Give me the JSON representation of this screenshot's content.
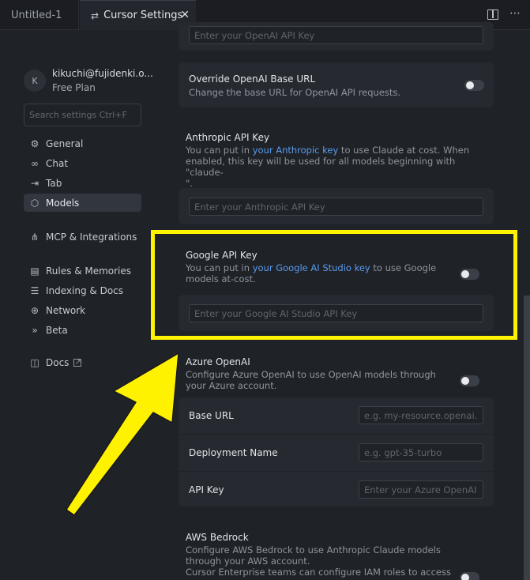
{
  "tabs": {
    "untitled": "Untitled-1",
    "settings": "Cursor Settings"
  },
  "user": {
    "initial": "K",
    "email": "kikuchi@fujidenki.o...",
    "plan": "Free Plan"
  },
  "sidebar": {
    "search_placeholder": "Search settings Ctrl+F",
    "items": [
      {
        "label": "General",
        "icon": "gear-icon"
      },
      {
        "label": "Chat",
        "icon": "infinity-icon"
      },
      {
        "label": "Tab",
        "icon": "arrow-right-bar-icon"
      },
      {
        "label": "Models",
        "icon": "cube-icon"
      },
      {
        "label": "MCP & Integrations",
        "icon": "network-nodes-icon"
      },
      {
        "label": "Rules & Memories",
        "icon": "document-icon"
      },
      {
        "label": "Indexing & Docs",
        "icon": "database-icon"
      },
      {
        "label": "Network",
        "icon": "globe-icon"
      },
      {
        "label": "Beta",
        "icon": "chevrons-right-icon"
      },
      {
        "label": "Docs",
        "icon": "book-icon"
      }
    ]
  },
  "main": {
    "openai_key_placeholder": "Enter your OpenAI API Key",
    "override_base": {
      "title": "Override OpenAI Base URL",
      "desc": "Change the base URL for OpenAI API requests."
    },
    "anthropic": {
      "title": "Anthropic API Key",
      "desc_pre": "You can put in ",
      "link": "your Anthropic key",
      "desc_post": " to use Claude at cost. When",
      "desc_line2": "enabled, this key will be used for all models beginning with \"claude-",
      "desc_line3": "\".",
      "placeholder": "Enter your Anthropic API Key"
    },
    "google": {
      "title": "Google API Key",
      "desc_pre": "You can put in ",
      "link": "your Google AI Studio key",
      "desc_post": " to use Google",
      "desc_line2": "models at-cost.",
      "placeholder": "Enter your Google AI Studio API Key"
    },
    "azure": {
      "title": "Azure OpenAI",
      "desc_line1": "Configure Azure OpenAI to use OpenAI models through",
      "desc_line2": "your Azure account.",
      "base_url_label": "Base URL",
      "base_url_placeholder": "e.g. my-resource.openai.azu",
      "deployment_label": "Deployment Name",
      "deployment_placeholder": "e.g. gpt-35-turbo",
      "api_key_label": "API Key",
      "api_key_placeholder": "Enter your Azure OpenAI AI"
    },
    "aws": {
      "title": "AWS Bedrock",
      "desc_line1": "Configure AWS Bedrock to use Anthropic Claude models",
      "desc_line2": "through your AWS account.",
      "desc_line3": "Cursor Enterprise teams can configure IAM roles to access"
    }
  },
  "annotation": {
    "highlight_color": "#fff200"
  }
}
